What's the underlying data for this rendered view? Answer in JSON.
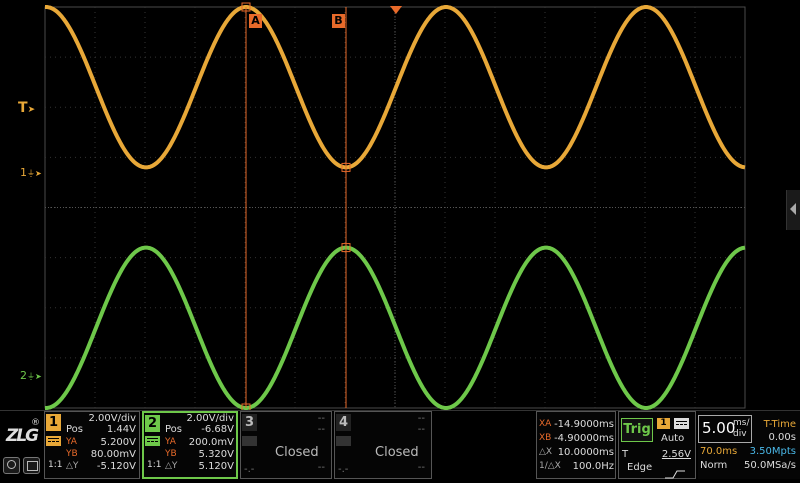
{
  "colors": {
    "ch1": "#e8a838",
    "ch2": "#6ec84a",
    "cursor": "#e86a2a",
    "grid": "#4a4a4a"
  },
  "screen": {
    "cursor_a_label": "A",
    "cursor_b_label": "B",
    "trigger_marker_label": "T",
    "ch1_marker_label": "1",
    "ch2_marker_label": "2",
    "right_arrow_icon": "chevron-left-icon"
  },
  "waveforms": [
    {
      "channel": 1,
      "type": "sine",
      "period_ms": 20.0,
      "amplitude_div": 1.6,
      "center_div": 2.4,
      "phase_note": "peak at cursor A"
    },
    {
      "channel": 2,
      "type": "sine",
      "period_ms": 20.0,
      "amplitude_div": 1.6,
      "center_div": -2.4,
      "phase_note": "trough at cursor A"
    }
  ],
  "logo": {
    "text": "ZLG",
    "registered": "®"
  },
  "ch1": {
    "num": "1",
    "scale": "2.00V/div",
    "pos_label": "Pos",
    "pos_value": "1.44V",
    "ya_label": "YA",
    "ya_value": "5.200V",
    "yb_label": "YB",
    "yb_value": "80.00mV",
    "dy_label": "△Y",
    "dy_value": "-5.120V",
    "coupling": "1:1"
  },
  "ch2": {
    "num": "2",
    "scale": "2.00V/div",
    "pos_label": "Pos",
    "pos_value": "-6.68V",
    "ya_label": "YA",
    "ya_value": "200.0mV",
    "yb_label": "YB",
    "yb_value": "5.320V",
    "dy_label": "△Y",
    "dy_value": "5.120V",
    "coupling": "1:1"
  },
  "ch3": {
    "num": "3",
    "status": "Closed",
    "dash": "--"
  },
  "ch4": {
    "num": "4",
    "status": "Closed",
    "dash": "--"
  },
  "cursor_readout": {
    "xa_label": "XA",
    "xa_value": "-14.9000ms",
    "xb_label": "XB",
    "xb_value": "-4.90000ms",
    "dx_label": "△X",
    "dx_value": "10.0000ms",
    "inv_dx_label": "1/△X",
    "inv_dx_value": "100.0Hz"
  },
  "trigger": {
    "label": "Trig",
    "source": "1",
    "mode": "Auto",
    "level_label": "T",
    "level": "2.56V",
    "type": "Edge"
  },
  "timebase": {
    "value": "5.00",
    "unit_top": "ms/",
    "unit_bottom": "div",
    "mode_label": "T-Time",
    "mode_value": "0.00s",
    "delay": "70.0ms",
    "mem_depth": "3.50Mpts",
    "acq_mode": "Norm",
    "sample_rate": "50.0MSa/s"
  }
}
